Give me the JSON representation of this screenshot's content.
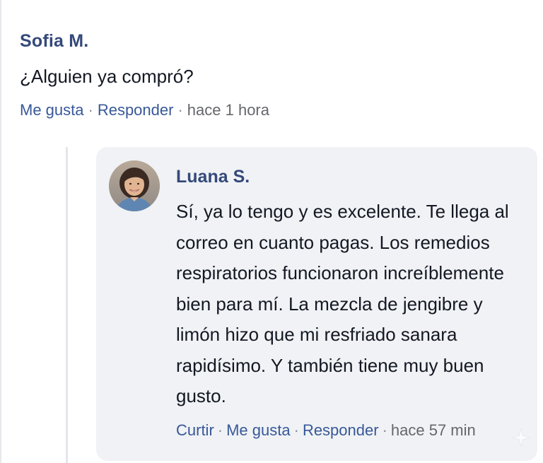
{
  "comment": {
    "author": "Sofia M.",
    "text": "¿Alguien ya compró?",
    "actions": {
      "like": "Me gusta",
      "reply": "Responder",
      "time": "hace 1 hora"
    }
  },
  "reply": {
    "author": "Luana S.",
    "text": "Sí, ya lo tengo y es excelente. Te llega al correo en cuanto pagas. Los remedios respiratorios funcionaron increíblemente bien para mí. La mezcla de jengibre y limón hizo que mi resfriado sanara rapidísimo. Y también tiene muy buen gusto.",
    "actions": {
      "share": "Curtir",
      "like": "Me gusta",
      "reply": "Responder",
      "time": "hace 57 min"
    },
    "avatar_icon": "user-avatar-photo"
  },
  "colors": {
    "author": "#34497a",
    "link": "#385898",
    "reply_bg": "#f0f2f5",
    "thread_line": "#e4e6eb"
  }
}
